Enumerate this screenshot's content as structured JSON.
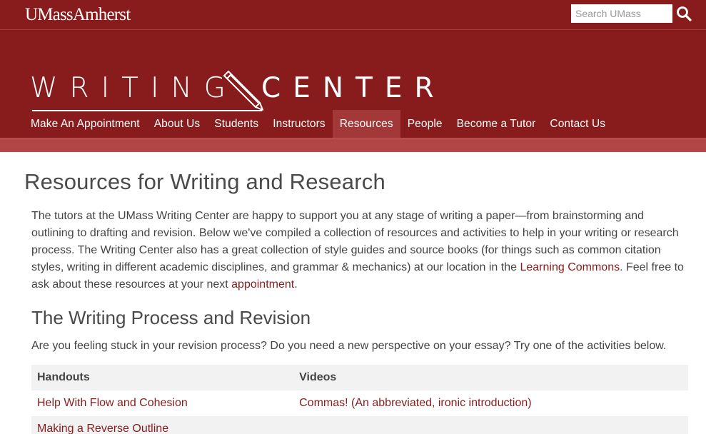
{
  "header": {
    "logo": "UMassAmherst",
    "search_placeholder": "Search UMass",
    "search_icon": "search-icon"
  },
  "banner": {
    "title_left": "WRITING",
    "title_right": "CENTER",
    "pencil_icon": "pencil-icon"
  },
  "nav": {
    "items": [
      {
        "label": "Make An Appointment"
      },
      {
        "label": "About Us"
      },
      {
        "label": "Students"
      },
      {
        "label": "Instructors"
      },
      {
        "label": "Resources"
      },
      {
        "label": "People"
      },
      {
        "label": "Become a Tutor"
      },
      {
        "label": "Contact Us"
      }
    ],
    "active": "Resources"
  },
  "main": {
    "title": "Resources for Writing and Research",
    "intro": {
      "part1": "The tutors at the UMass Writing Center are happy to support you at any stage of writing a paper—from brainstorming and outlining to drafting and revision. Below we've compiled a collection of resources and activities to help in your writing or research process. The Writing Center also has a great collection of style guides and source books (for things such as common citation styles, writing in different academic disciplines, and grammar & mechanics) at our location in the ",
      "link1": "Learning Commons",
      "part2": ". Feel free to ask about these resources at your next ",
      "link2": "appointment",
      "part3": "."
    },
    "section_heading": "The Writing Process and Revision",
    "section_intro": "Are you feeling stuck in your revision process? Do you need a new perspective on your essay? Try one of the activities below.",
    "table": {
      "headers": [
        "Handouts",
        "Videos"
      ],
      "rows": [
        [
          "Help With Flow and Cohesion",
          "Commas! (An abbreviated, ironic introduction)"
        ],
        [
          "Making a Reverse Outline",
          ""
        ]
      ]
    }
  },
  "colors": {
    "maroon": "#881c1c",
    "nav_active": "#a33838",
    "stripe": "#b24545"
  }
}
